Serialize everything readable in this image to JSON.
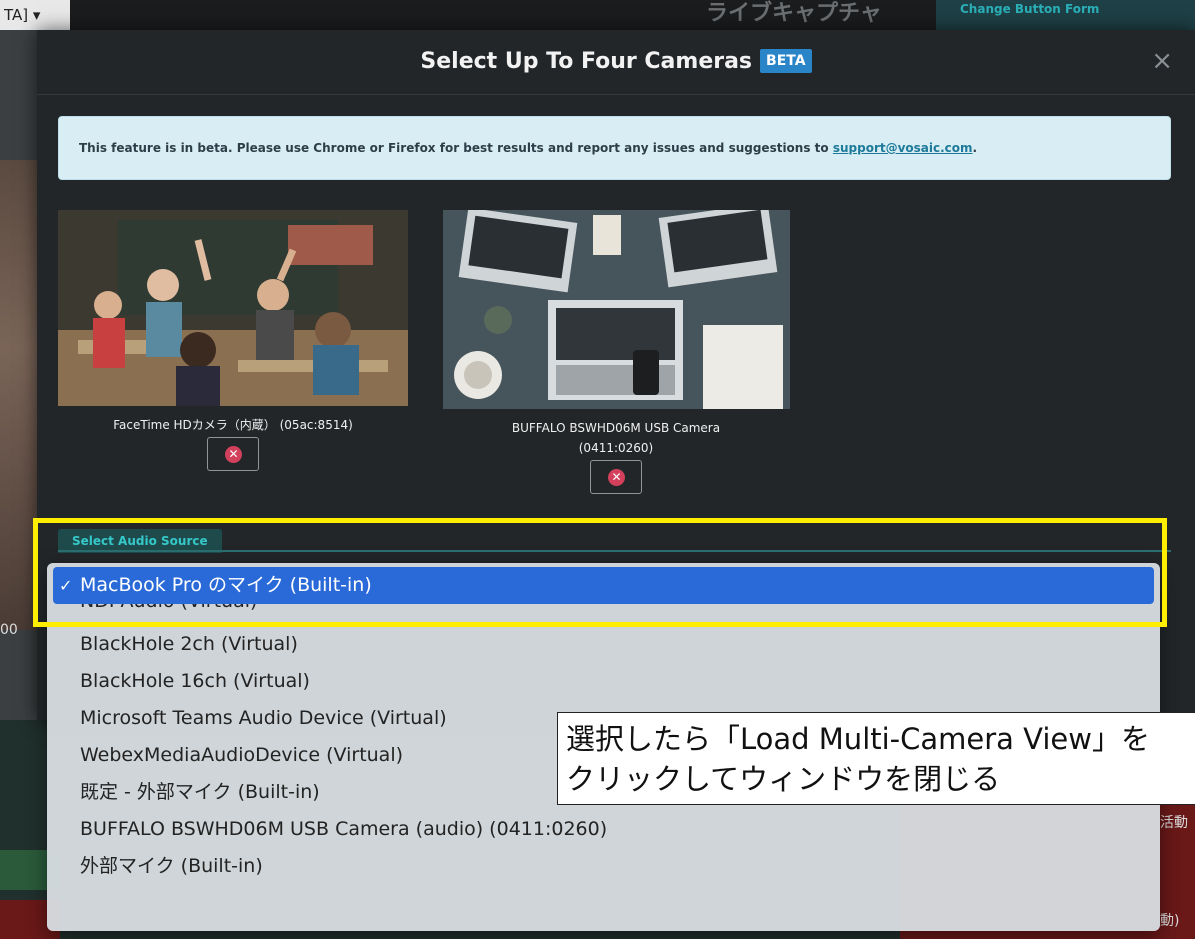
{
  "background": {
    "tag_label": "TA] ▾",
    "capture_label": "ライブキャプチャ",
    "change_button_label": "Change Button Form",
    "left_number": "00",
    "edge_text_1": "活動",
    "edge_text_2": "動)"
  },
  "modal": {
    "title": "Select Up To Four Cameras",
    "beta_badge": "BETA",
    "close_icon": "×",
    "alert_text": "This feature is in beta. Please use Chrome or Firefox for best results and report any issues and suggestions to ",
    "alert_link": "support@vosaic.com",
    "alert_suffix": "."
  },
  "cameras": [
    {
      "label": "FaceTime HDカメラ（内蔵） (05ac:8514)",
      "image_icon": "classroom-photo",
      "remove_icon": "remove-circle-icon"
    },
    {
      "label_line1": "BUFFALO BSWHD06M USB Camera",
      "label_line2": "(0411:0260)",
      "image_icon": "laptops-desk-photo",
      "remove_icon": "remove-circle-icon"
    }
  ],
  "audio": {
    "tab_label": "Select Audio Source",
    "selected_check": "✓",
    "options": [
      "MacBook Pro のマイク (Built-in)",
      "NDI Audio (Virtual)",
      "BlackHole 2ch (Virtual)",
      "BlackHole 16ch (Virtual)",
      "Microsoft Teams Audio Device (Virtual)",
      "WebexMediaAudioDevice (Virtual)",
      "既定 - 外部マイク (Built-in)",
      "BUFFALO BSWHD06M USB Camera (audio) (0411:0260)",
      "外部マイク (Built-in)"
    ]
  },
  "annotation": {
    "line1": "選択したら「Load Multi-Camera View」を",
    "line2": "クリックしてウィンドウを閉じる",
    "highlight_color": "#ffee00"
  },
  "colors": {
    "modal_bg": "#222628",
    "beta_badge": "#2a84c8",
    "selected_option": "#2a6ad8",
    "remove_icon": "#d2405c",
    "audio_tab_text": "#36c8c8"
  }
}
